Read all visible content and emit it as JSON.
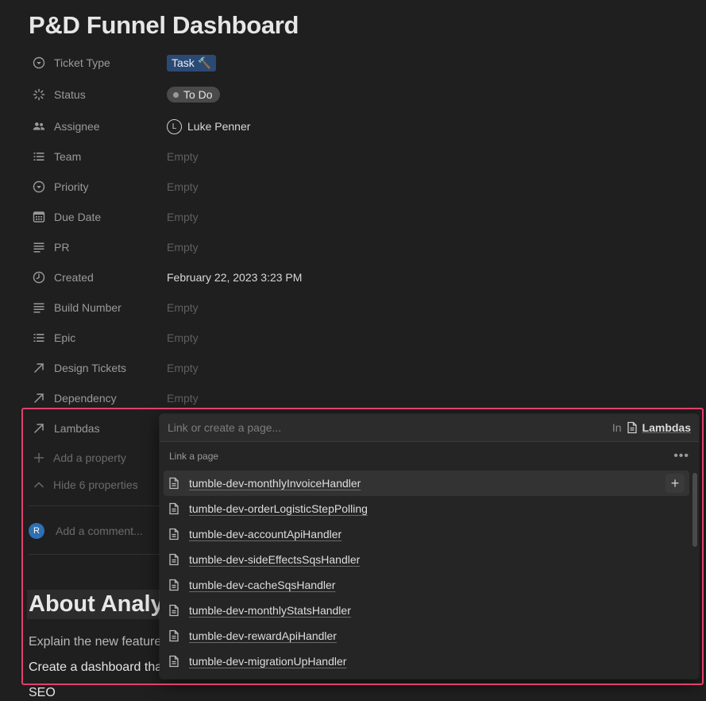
{
  "page": {
    "title": "P&D Funnel Dashboard"
  },
  "properties": [
    {
      "name": "Ticket Type",
      "icon": "chevron-circle-icon",
      "value": "Task 🔨",
      "kind": "tag-task"
    },
    {
      "name": "Status",
      "icon": "status-spinner-icon",
      "value": "To Do",
      "kind": "tag-status"
    },
    {
      "name": "Assignee",
      "icon": "people-icon",
      "value": "Luke Penner",
      "avatar_letter": "L",
      "kind": "person"
    },
    {
      "name": "Team",
      "icon": "list-icon",
      "value": "Empty",
      "kind": "empty"
    },
    {
      "name": "Priority",
      "icon": "chevron-circle-icon",
      "value": "Empty",
      "kind": "empty"
    },
    {
      "name": "Due Date",
      "icon": "calendar-icon",
      "value": "Empty",
      "kind": "empty"
    },
    {
      "name": "PR",
      "icon": "text-lines-icon",
      "value": "Empty",
      "kind": "empty"
    },
    {
      "name": "Created",
      "icon": "clock-icon",
      "value": "February 22, 2023 3:23 PM",
      "kind": "text"
    },
    {
      "name": "Build Number",
      "icon": "text-lines-icon",
      "value": "Empty",
      "kind": "empty"
    },
    {
      "name": "Epic",
      "icon": "list-icon",
      "value": "Empty",
      "kind": "empty"
    },
    {
      "name": "Design Tickets",
      "icon": "relation-arrow-icon",
      "value": "Empty",
      "kind": "empty"
    },
    {
      "name": "Dependency",
      "icon": "relation-arrow-icon",
      "value": "Empty",
      "kind": "empty"
    },
    {
      "name": "Lambdas",
      "icon": "relation-arrow-icon",
      "value": "",
      "kind": "empty"
    }
  ],
  "actions": {
    "add_property": "Add a property",
    "hide_properties": "Hide 6 properties",
    "comment_placeholder": "Add a comment...",
    "comment_avatar_letter": "R"
  },
  "content": {
    "heading": "About Analy",
    "line1": "Explain the new feature",
    "line2": "Create a dashboard tha",
    "line3": "SEO"
  },
  "popup": {
    "search_placeholder": "Link or create a page...",
    "in_label": "In",
    "database_name": "Lambdas",
    "section_label": "Link a page",
    "more_label": "•••",
    "items": [
      "tumble-dev-monthlyInvoiceHandler",
      "tumble-dev-orderLogisticStepPolling",
      "tumble-dev-accountApiHandler",
      "tumble-dev-sideEffectsSqsHandler",
      "tumble-dev-cacheSqsHandler",
      "tumble-dev-monthlyStatsHandler",
      "tumble-dev-rewardApiHandler",
      "tumble-dev-migrationUpHandler"
    ],
    "plus_label": "+"
  },
  "colors": {
    "background": "#1f1f1f",
    "highlight_frame": "#e2406a",
    "task_tag": "#2a4a74",
    "status_tag": "#4a4a4a",
    "comment_avatar": "#2f6fb3"
  }
}
